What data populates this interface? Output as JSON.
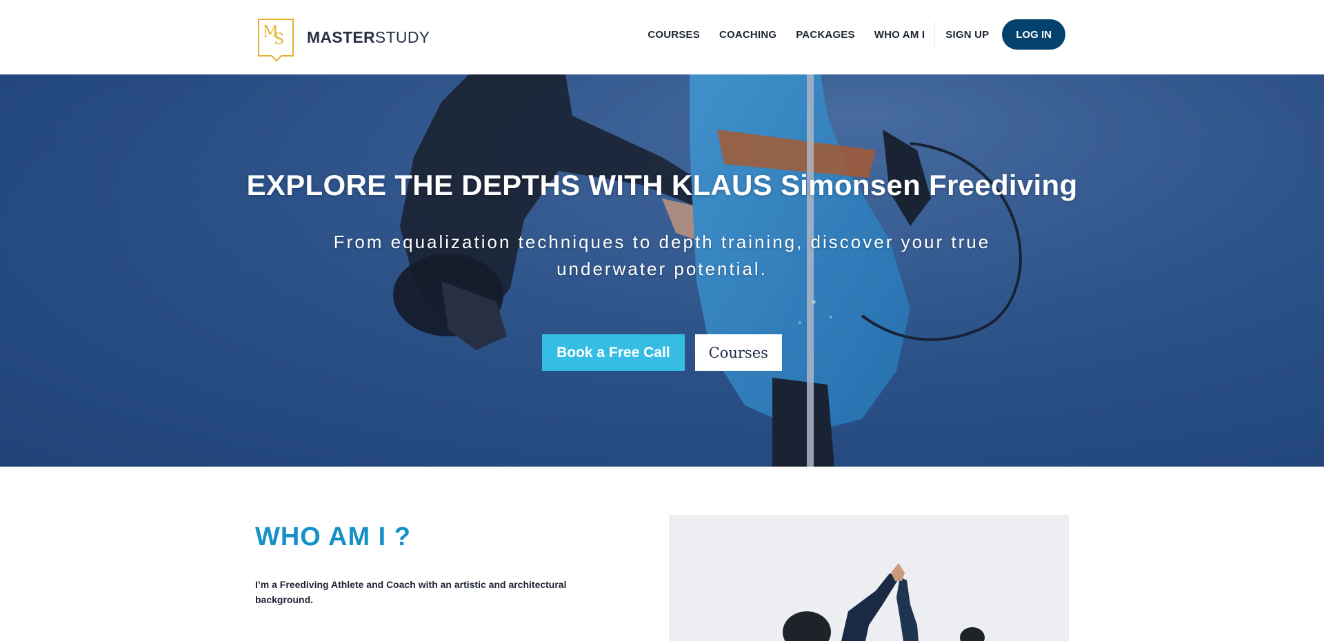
{
  "header": {
    "logo": {
      "mark_m": "M",
      "mark_s": "S",
      "brand_bold": "MASTER",
      "brand_light": "STUDY"
    },
    "nav": {
      "items": [
        "COURSES",
        "COACHING",
        "PACKAGES",
        "WHO AM I",
        "SIGN UP"
      ],
      "login_label": "LOG IN"
    }
  },
  "hero": {
    "title": "EXPLORE THE DEPTHS WITH KLAUS Simonsen Freediving",
    "subtitle": "From equalization techniques to depth training, discover your true underwater potential.",
    "primary_button": "Book a Free Call",
    "secondary_button": "Courses"
  },
  "about": {
    "title": "WHO AM I ?",
    "text": "I’m a Freediving Athlete and Coach with an artistic and architectural background."
  },
  "colors": {
    "logo_gold": "#e4b031",
    "login_navy": "#04426e",
    "accent_cyan": "#35bde3",
    "heading_blue": "#1591c7",
    "hero_water": "#2f5a93"
  }
}
